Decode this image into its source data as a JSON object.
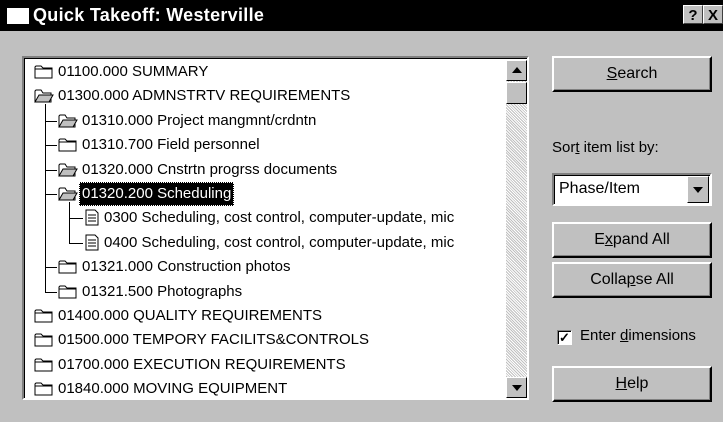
{
  "window": {
    "title": "Quick Takeoff:  Westerville",
    "help_button": "?",
    "close_button": "X"
  },
  "tree": {
    "items": [
      {
        "label": "01100.000  SUMMARY",
        "level": 0,
        "icon": "folder-closed-icon"
      },
      {
        "label": "01300.000  ADMNSTRTV REQUIREMENTS",
        "level": 0,
        "icon": "folder-open-icon"
      },
      {
        "label": "01310.000  Project mangmnt/crdntn",
        "level": 1,
        "icon": "folder-open-icon"
      },
      {
        "label": "01310.700  Field personnel",
        "level": 1,
        "icon": "folder-closed-icon"
      },
      {
        "label": "01320.000  Cnstrtn progrss documents",
        "level": 1,
        "icon": "folder-open-icon"
      },
      {
        "label": "01320.200  Scheduling",
        "level": 1,
        "icon": "folder-open-icon",
        "selected": true
      },
      {
        "label": "0300  Scheduling, cost control, computer-update, mic",
        "level": 2,
        "icon": "document-icon"
      },
      {
        "label": "0400  Scheduling, cost control, computer-update, mic",
        "level": 2,
        "icon": "document-icon"
      },
      {
        "label": "01321.000  Construction photos",
        "level": 1,
        "icon": "folder-closed-icon"
      },
      {
        "label": "01321.500  Photographs",
        "level": 1,
        "icon": "folder-closed-icon"
      },
      {
        "label": "01400.000  QUALITY REQUIREMENTS",
        "level": 0,
        "icon": "folder-closed-icon"
      },
      {
        "label": "01500.000  TEMPORY FACILITS&CONTROLS",
        "level": 0,
        "icon": "folder-closed-icon"
      },
      {
        "label": "01700.000  EXECUTION REQUIREMENTS",
        "level": 0,
        "icon": "folder-closed-icon"
      },
      {
        "label": "01840.000  MOVING EQUIPMENT",
        "level": 0,
        "icon": "folder-closed-icon"
      }
    ]
  },
  "sidebar": {
    "search_label": "Search",
    "sort_label": "Sort item list by:",
    "sort_value": "Phase/Item",
    "expand_all_label": "Expand All",
    "collapse_all_label": "Collapse All",
    "enter_dimensions_label": "Enter dimensions",
    "enter_dimensions_checked": true,
    "help_label": "Help"
  }
}
